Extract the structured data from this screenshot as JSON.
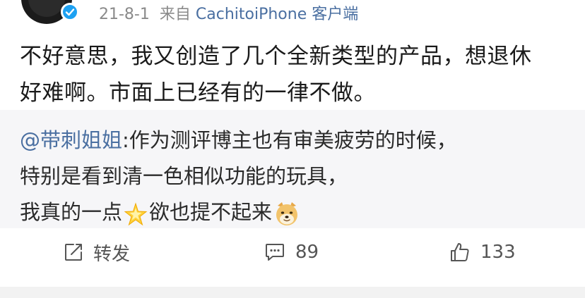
{
  "header": {
    "date": "21-8-1",
    "source_prefix": "来自",
    "source": "CachitoiPhone 客户端"
  },
  "post": {
    "line1": "不好意思，我又创造了几个全新类型的产品，想退休",
    "line2": "好难啊。市面上已经有的一律不做。"
  },
  "quote": {
    "mention": "@带刺姐姐",
    "line1_rest": ":作为测评博主也有审美疲劳的时候，",
    "line2": "特别是看到清一色相似功能的玩具，",
    "line3_a": "我真的一点",
    "line3_b": "欲也提不起来"
  },
  "actions": {
    "repost_label": "转发",
    "comment_count": "89",
    "like_count": "133"
  },
  "icons": {
    "verified": "verified-badge-icon",
    "repost": "repost-icon",
    "comment": "comment-icon",
    "like": "thumbs-up-icon",
    "star_emoji": "sparkle-star-emoji",
    "dog_emoji": "doge-emoji"
  },
  "colors": {
    "link": "#4a6fa1",
    "meta": "#8a8a8a",
    "verified": "#1da1f2",
    "quote_bg": "#f6f6f8"
  }
}
